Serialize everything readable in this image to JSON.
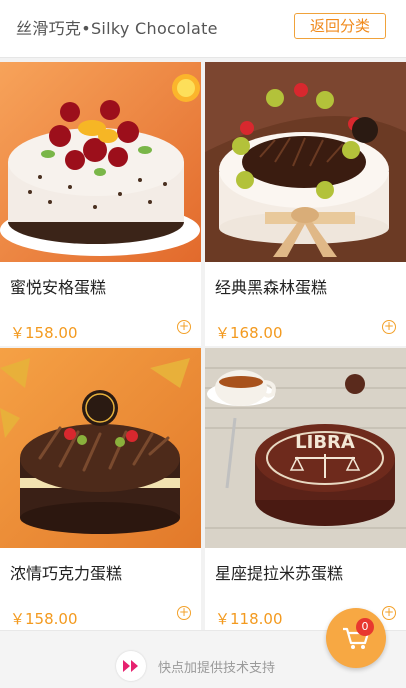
{
  "header": {
    "title": "丝滑巧克•Silky Chocolate",
    "back_label": "返回分类"
  },
  "products": [
    {
      "name": "蜜悦安格蛋糕",
      "price": "￥158.00",
      "add_label": "+"
    },
    {
      "name": "经典黑森林蛋糕",
      "price": "￥168.00",
      "add_label": "+"
    },
    {
      "name": "浓情巧克力蛋糕",
      "price": "￥158.00",
      "add_label": "+"
    },
    {
      "name": "星座提拉米苏蛋糕",
      "price": "￥118.00",
      "add_label": "+"
    }
  ],
  "footer": {
    "powered_by": "快点加提供技术支持"
  },
  "cart": {
    "count": "0"
  },
  "colors": {
    "accent": "#f39a1f",
    "badge": "#e8382f",
    "fab": "#f7a843"
  }
}
